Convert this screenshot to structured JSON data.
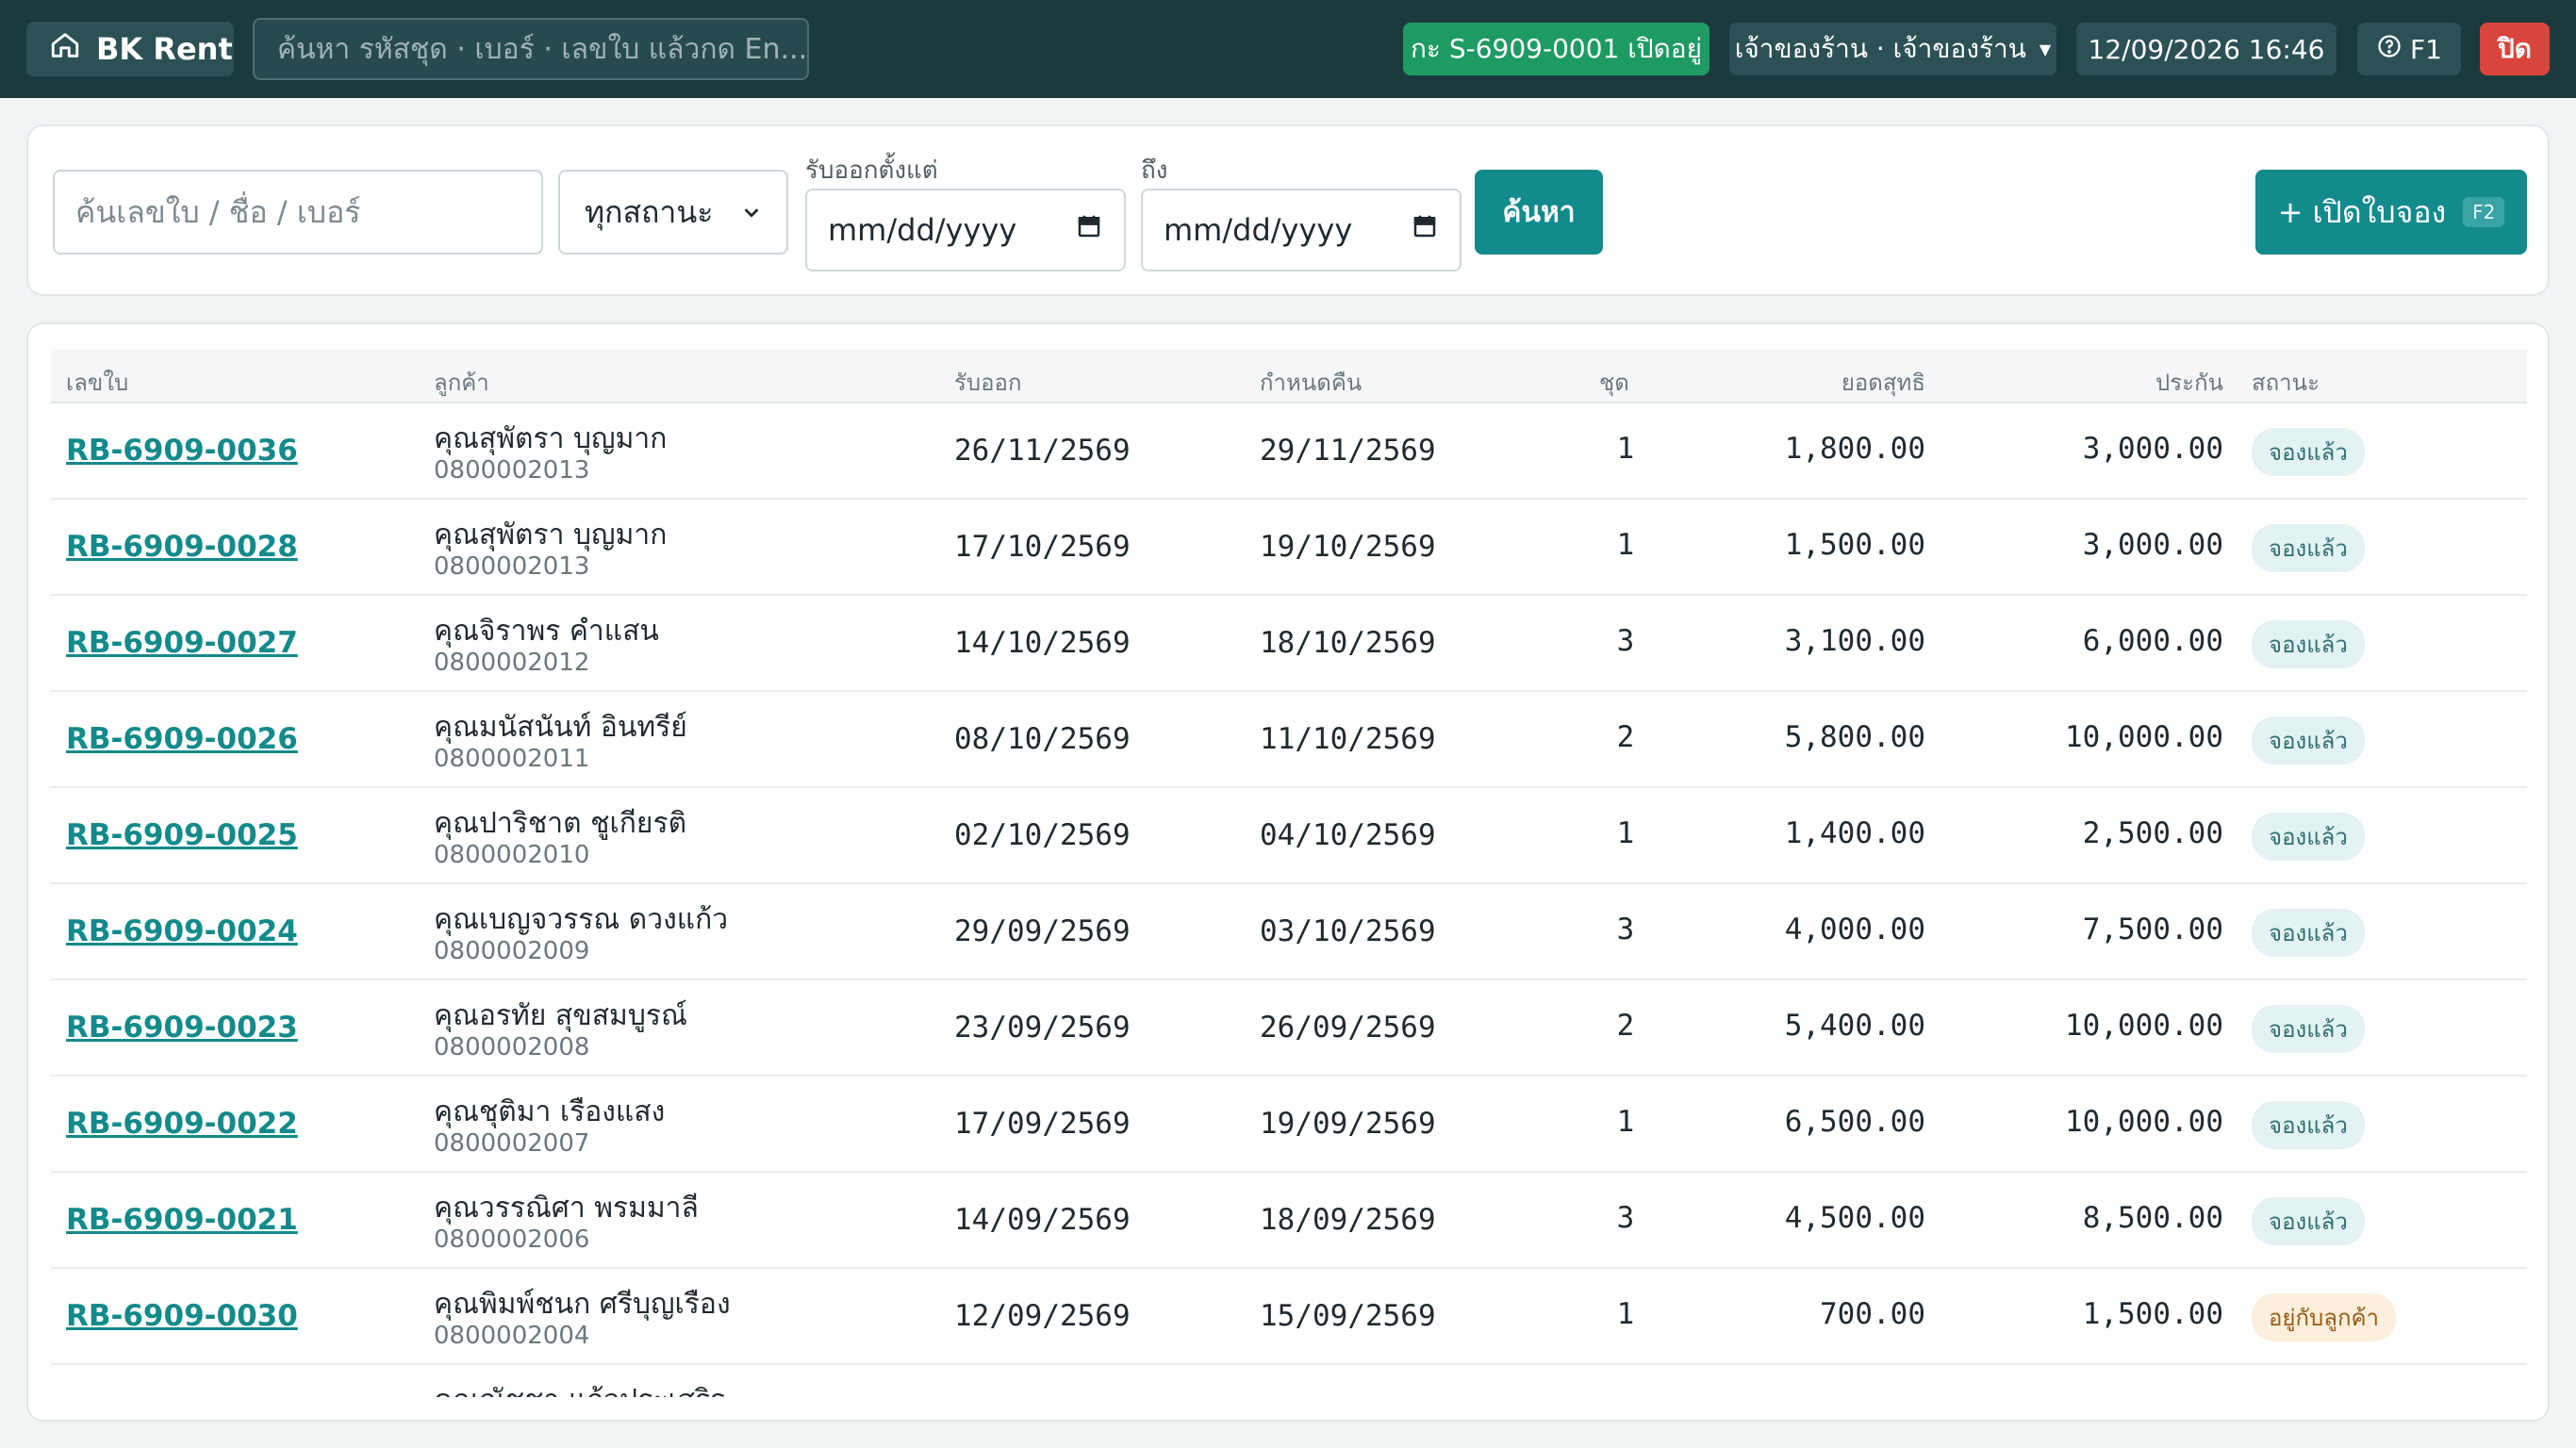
{
  "topbar": {
    "brand": "BK Rent",
    "global_search_placeholder": "ค้นหา รหัสชุด · เบอร์ · เลขใบ แล้วกด En...",
    "shift_badge": "กะ S-6909-0001 เปิดอยู่",
    "user_menu": "เจ้าของร้าน · เจ้าของร้าน",
    "datetime": "12/09/2026 16:46",
    "help_label": "F1",
    "close_label": "ปิด"
  },
  "filters": {
    "search_placeholder": "ค้นเลขใบ / ชื่อ / เบอร์",
    "status_value": "ทุกสถานะ",
    "from_label": "รับออกตั้งแต่",
    "from_placeholder": "mm/dd/yyyy",
    "to_label": "ถึง",
    "to_placeholder": "mm/dd/yyyy",
    "search_button": "ค้นหา",
    "new_button": "+ เปิดใบจอง",
    "new_button_key": "F2"
  },
  "table": {
    "headers": {
      "no": "เลขใบ",
      "customer": "ลูกค้า",
      "pickup": "รับออก",
      "due": "กำหนดคืน",
      "sets": "ชุด",
      "net": "ยอดสุทธิ",
      "deposit": "ประกัน",
      "status": "สถานะ"
    },
    "rows": [
      {
        "no": "RB-6909-0036",
        "name": "คุณสุพัตรา บุญมาก",
        "phone": "0800002013",
        "pickup": "26/11/2569",
        "due": "29/11/2569",
        "sets": "1",
        "net": "1,800.00",
        "deposit": "3,000.00",
        "status": "จองแล้ว",
        "status_kind": "booked"
      },
      {
        "no": "RB-6909-0028",
        "name": "คุณสุพัตรา บุญมาก",
        "phone": "0800002013",
        "pickup": "17/10/2569",
        "due": "19/10/2569",
        "sets": "1",
        "net": "1,500.00",
        "deposit": "3,000.00",
        "status": "จองแล้ว",
        "status_kind": "booked"
      },
      {
        "no": "RB-6909-0027",
        "name": "คุณจิราพร คำแสน",
        "phone": "0800002012",
        "pickup": "14/10/2569",
        "due": "18/10/2569",
        "sets": "3",
        "net": "3,100.00",
        "deposit": "6,000.00",
        "status": "จองแล้ว",
        "status_kind": "booked"
      },
      {
        "no": "RB-6909-0026",
        "name": "คุณมนัสนันท์ อินทรีย์",
        "phone": "0800002011",
        "pickup": "08/10/2569",
        "due": "11/10/2569",
        "sets": "2",
        "net": "5,800.00",
        "deposit": "10,000.00",
        "status": "จองแล้ว",
        "status_kind": "booked"
      },
      {
        "no": "RB-6909-0025",
        "name": "คุณปาริชาต ชูเกียรติ",
        "phone": "0800002010",
        "pickup": "02/10/2569",
        "due": "04/10/2569",
        "sets": "1",
        "net": "1,400.00",
        "deposit": "2,500.00",
        "status": "จองแล้ว",
        "status_kind": "booked"
      },
      {
        "no": "RB-6909-0024",
        "name": "คุณเบญจวรรณ ดวงแก้ว",
        "phone": "0800002009",
        "pickup": "29/09/2569",
        "due": "03/10/2569",
        "sets": "3",
        "net": "4,000.00",
        "deposit": "7,500.00",
        "status": "จองแล้ว",
        "status_kind": "booked"
      },
      {
        "no": "RB-6909-0023",
        "name": "คุณอรทัย สุขสมบูรณ์",
        "phone": "0800002008",
        "pickup": "23/09/2569",
        "due": "26/09/2569",
        "sets": "2",
        "net": "5,400.00",
        "deposit": "10,000.00",
        "status": "จองแล้ว",
        "status_kind": "booked"
      },
      {
        "no": "RB-6909-0022",
        "name": "คุณชุติมา เรืองแสง",
        "phone": "0800002007",
        "pickup": "17/09/2569",
        "due": "19/09/2569",
        "sets": "1",
        "net": "6,500.00",
        "deposit": "10,000.00",
        "status": "จองแล้ว",
        "status_kind": "booked"
      },
      {
        "no": "RB-6909-0021",
        "name": "คุณวรรณิศา พรมมาลี",
        "phone": "0800002006",
        "pickup": "14/09/2569",
        "due": "18/09/2569",
        "sets": "3",
        "net": "4,500.00",
        "deposit": "8,500.00",
        "status": "จองแล้ว",
        "status_kind": "booked"
      },
      {
        "no": "RB-6909-0030",
        "name": "คุณพิมพ์ชนก ศรีบุญเรือง",
        "phone": "0800002004",
        "pickup": "12/09/2569",
        "due": "15/09/2569",
        "sets": "1",
        "net": "700.00",
        "deposit": "1,500.00",
        "status": "อยู่กับลูกค้า",
        "status_kind": "with"
      },
      {
        "no": "",
        "name": "คุณณัชชา แก้วประเสริฐ",
        "phone": "",
        "pickup": "",
        "due": "",
        "sets": "",
        "net": "",
        "deposit": "",
        "status": "",
        "status_kind": "with"
      }
    ]
  },
  "colors": {
    "topbar": "#1b3a3e",
    "accent": "#138a8c",
    "shift": "#1e9a63",
    "danger": "#d9453b"
  }
}
